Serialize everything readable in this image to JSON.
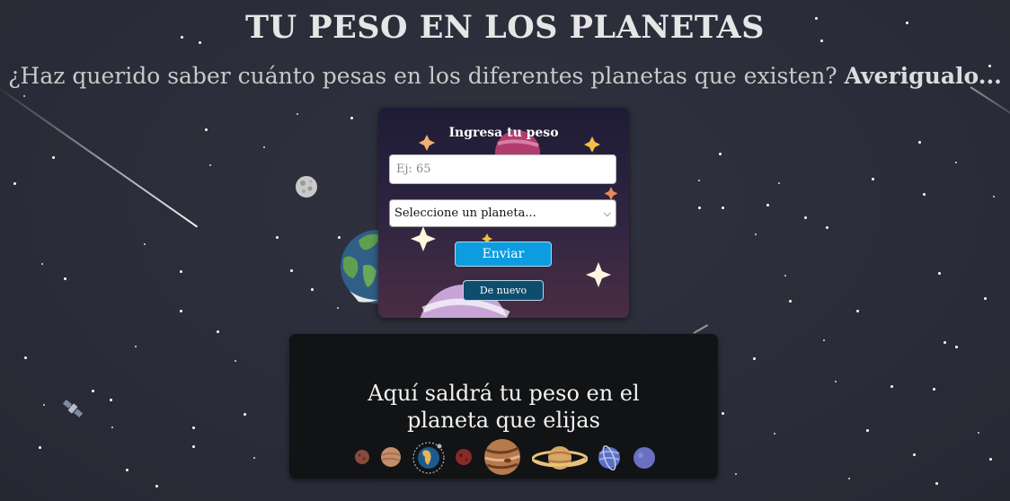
{
  "page": {
    "title": "TU PESO EN LOS PLANETAS",
    "subtitle": "¿Haz querido saber cuánto pesas en los diferentes planetas que existen?",
    "subtitle_bold": "Averigualo..."
  },
  "form": {
    "label": "Ingresa tu peso",
    "weight_placeholder": "Ej: 65",
    "weight_value": "",
    "planet_select_value": "Seleccione un planeta...",
    "submit_label": "Enviar",
    "reset_label": "De nuevo"
  },
  "result": {
    "message": "Aquí saldrá tu peso en el planeta que elijas",
    "planet_icons": [
      "mercury-icon",
      "venus-icon",
      "earth-icon",
      "mars-icon",
      "jupiter-icon",
      "saturn-icon",
      "uranus-icon",
      "neptune-icon"
    ]
  },
  "decorations": {
    "icons": [
      "moon-icon",
      "earth-planet-icon",
      "satellite-icon",
      "comet-icon",
      "sparkle-icon"
    ],
    "colors": {
      "background": "#2b2d3c",
      "send_button": "#0b9de0",
      "reset_button": "#0e4d6d",
      "result_panel": "#111315"
    }
  }
}
